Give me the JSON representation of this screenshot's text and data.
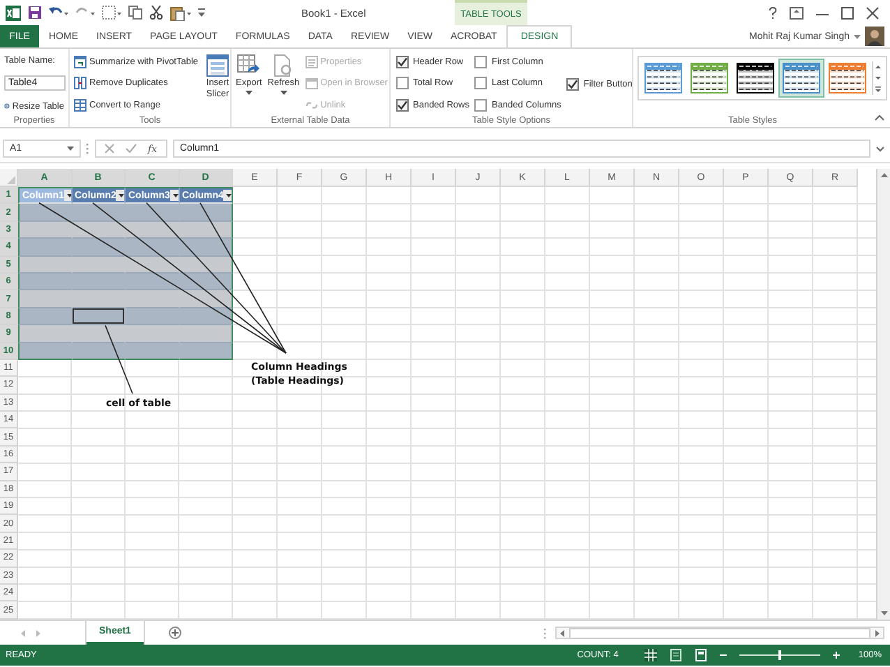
{
  "title_bar": {
    "title": "Book1 - Excel",
    "context_label": "TABLE TOOLS",
    "user": "Mohit Raj Kumar Singh"
  },
  "ribbon_tabs": [
    {
      "label": "FILE",
      "kind": "file",
      "selected": false
    },
    {
      "label": "HOME",
      "kind": "tab",
      "selected": false
    },
    {
      "label": "INSERT",
      "kind": "tab",
      "selected": false
    },
    {
      "label": "PAGE LAYOUT",
      "kind": "tab",
      "selected": false
    },
    {
      "label": "FORMULAS",
      "kind": "tab",
      "selected": false
    },
    {
      "label": "DATA",
      "kind": "tab",
      "selected": false
    },
    {
      "label": "REVIEW",
      "kind": "tab",
      "selected": false
    },
    {
      "label": "VIEW",
      "kind": "tab",
      "selected": false
    },
    {
      "label": "ACROBAT",
      "kind": "tab",
      "selected": false
    },
    {
      "label": "DESIGN",
      "kind": "tab",
      "selected": true
    }
  ],
  "ribbon": {
    "properties": {
      "name_label": "Table Name:",
      "table_name": "Table4",
      "resize": "Resize Table",
      "group_label": "Properties"
    },
    "tools": {
      "commands": [
        "Summarize with PivotTable",
        "Remove Duplicates",
        "Convert to Range"
      ],
      "slicer": "Insert Slicer",
      "group_label": "Tools"
    },
    "external": {
      "big": [
        {
          "label": "Export"
        },
        {
          "label": "Refresh"
        }
      ],
      "small": [
        {
          "label": "Properties",
          "disabled": true
        },
        {
          "label": "Open in Browser",
          "disabled": true
        },
        {
          "label": "Unlink",
          "disabled": true
        }
      ],
      "group_label": "External Table Data"
    },
    "style_options": {
      "options": [
        {
          "label": "Header Row",
          "checked": true
        },
        {
          "label": "Total Row",
          "checked": false
        },
        {
          "label": "Banded Rows",
          "checked": true
        },
        {
          "label": "First Column",
          "checked": false
        },
        {
          "label": "Last Column",
          "checked": false
        },
        {
          "label": "Banded Columns",
          "checked": false
        },
        {
          "label": "Filter Button",
          "checked": true
        }
      ],
      "group_label": "Table Style Options"
    },
    "table_styles": {
      "swatches": [
        {
          "color": "#5b9bd5",
          "selected": false
        },
        {
          "color": "#70ad47",
          "selected": false
        },
        {
          "color": "#000000",
          "selected": false
        },
        {
          "color": "#4a90c8",
          "selected": true
        },
        {
          "color": "#ed7d31",
          "selected": false
        }
      ],
      "group_label": "Table Styles"
    }
  },
  "formula_bar": {
    "name_box": "A1",
    "function_label": "fx",
    "value": "Column1"
  },
  "grid": {
    "columns": [
      {
        "label": "A",
        "highlighted": true
      },
      {
        "label": "B",
        "highlighted": true
      },
      {
        "label": "C",
        "highlighted": true
      },
      {
        "label": "D",
        "highlighted": true
      },
      {
        "label": "E",
        "highlighted": false
      },
      {
        "label": "F",
        "highlighted": false
      },
      {
        "label": "G",
        "highlighted": false
      },
      {
        "label": "H",
        "highlighted": false
      },
      {
        "label": "I",
        "highlighted": false
      },
      {
        "label": "J",
        "highlighted": false
      },
      {
        "label": "K",
        "highlighted": false
      },
      {
        "label": "L",
        "highlighted": false
      },
      {
        "label": "M",
        "highlighted": false
      },
      {
        "label": "N",
        "highlighted": false
      },
      {
        "label": "O",
        "highlighted": false
      },
      {
        "label": "P",
        "highlighted": false
      },
      {
        "label": "Q",
        "highlighted": false
      },
      {
        "label": "R",
        "highlighted": false
      }
    ],
    "rows": [
      {
        "label": "1",
        "highlighted": true
      },
      {
        "label": "2",
        "highlighted": true
      },
      {
        "label": "3",
        "highlighted": true
      },
      {
        "label": "4",
        "highlighted": true
      },
      {
        "label": "5",
        "highlighted": true
      },
      {
        "label": "6",
        "highlighted": true
      },
      {
        "label": "7",
        "highlighted": true
      },
      {
        "label": "8",
        "highlighted": true
      },
      {
        "label": "9",
        "highlighted": true
      },
      {
        "label": "10",
        "highlighted": true
      },
      {
        "label": "11",
        "highlighted": false
      },
      {
        "label": "12",
        "highlighted": false
      },
      {
        "label": "13",
        "highlighted": false
      },
      {
        "label": "14",
        "highlighted": false
      },
      {
        "label": "15",
        "highlighted": false
      },
      {
        "label": "16",
        "highlighted": false
      },
      {
        "label": "17",
        "highlighted": false
      },
      {
        "label": "18",
        "highlighted": false
      },
      {
        "label": "19",
        "highlighted": false
      },
      {
        "label": "20",
        "highlighted": false
      },
      {
        "label": "21",
        "highlighted": false
      },
      {
        "label": "22",
        "highlighted": false
      },
      {
        "label": "23",
        "highlighted": false
      },
      {
        "label": "24",
        "highlighted": false
      },
      {
        "label": "25",
        "highlighted": false
      }
    ]
  },
  "table": {
    "headers": [
      {
        "label": "Column1",
        "selected": true
      },
      {
        "label": "Column2",
        "selected": false
      },
      {
        "label": "Column3",
        "selected": false
      },
      {
        "label": "Column4",
        "selected": false
      }
    ],
    "body": [
      {
        "cells": [
          {
            "outlined": false
          },
          {
            "outlined": false
          },
          {
            "outlined": false
          },
          {
            "outlined": false
          }
        ]
      },
      {
        "cells": [
          {
            "outlined": false
          },
          {
            "outlined": false
          },
          {
            "outlined": false
          },
          {
            "outlined": false
          }
        ]
      },
      {
        "cells": [
          {
            "outlined": false
          },
          {
            "outlined": false
          },
          {
            "outlined": false
          },
          {
            "outlined": false
          }
        ]
      },
      {
        "cells": [
          {
            "outlined": false
          },
          {
            "outlined": false
          },
          {
            "outlined": false
          },
          {
            "outlined": false
          }
        ]
      },
      {
        "cells": [
          {
            "outlined": false
          },
          {
            "outlined": false
          },
          {
            "outlined": false
          },
          {
            "outlined": false
          }
        ]
      },
      {
        "cells": [
          {
            "outlined": false
          },
          {
            "outlined": false
          },
          {
            "outlined": false
          },
          {
            "outlined": false
          }
        ]
      },
      {
        "cells": [
          {
            "outlined": false
          },
          {
            "outlined": true
          },
          {
            "outlined": false
          },
          {
            "outlined": false
          }
        ]
      },
      {
        "cells": [
          {
            "outlined": false
          },
          {
            "outlined": false
          },
          {
            "outlined": false
          },
          {
            "outlined": false
          }
        ]
      },
      {
        "cells": [
          {
            "outlined": false
          },
          {
            "outlined": false
          },
          {
            "outlined": false
          },
          {
            "outlined": false
          }
        ]
      }
    ]
  },
  "annotations": [
    {
      "kind": "headings",
      "lines": [
        "Column Headings",
        "(Table Headings)"
      ]
    },
    {
      "kind": "cell",
      "lines": [
        "cell of table"
      ]
    }
  ],
  "sheets": [
    {
      "label": "Sheet1",
      "selected": true
    }
  ],
  "status_bar": {
    "mode": "READY",
    "count": "COUNT: 4",
    "zoom": "100%",
    "zoom_slider": {
      "level": 0.5
    }
  }
}
